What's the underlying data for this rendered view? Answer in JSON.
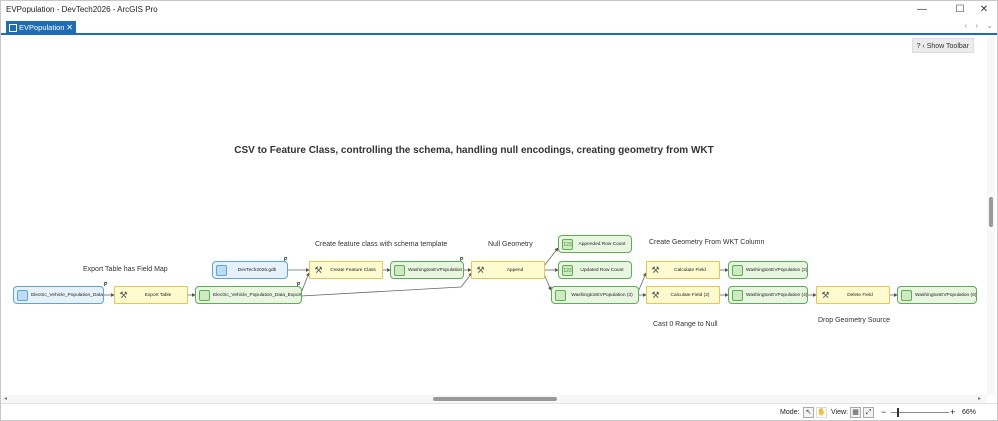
{
  "window": {
    "title": "EVPopulation - DevTech2026 - ArcGIS Pro",
    "minimize_glyph": "—",
    "maximize_glyph": "☐",
    "close_glyph": "✕"
  },
  "tab": {
    "label": "EVPopulation",
    "close_glyph": "✕"
  },
  "tab_nav": {
    "arrows": "‹ ›",
    "menu": "⌄"
  },
  "canvas": {
    "help_glyph": "?",
    "show_toolbar_label": "‹ Show Toolbar",
    "model_title": "CSV to Feature Class, controlling the schema, handling null encodings, creating geometry from WKT"
  },
  "nodes": [
    {
      "id": "n-csv",
      "kind": "data",
      "text": "Electric_Vehicle_Population_Data.csv"
    },
    {
      "id": "n-export-table",
      "kind": "tool",
      "text": "Export Table"
    },
    {
      "id": "n-export-output",
      "kind": "out",
      "text": "Electric_Vehicle_Population_Data_ExportTable"
    },
    {
      "id": "n-gdb",
      "kind": "data",
      "text": "DevTech2026.gdb"
    },
    {
      "id": "n-create-fc",
      "kind": "tool",
      "text": "Create Feature Class"
    },
    {
      "id": "n-wa-1",
      "kind": "out",
      "text": "WashingtonEVPopulation"
    },
    {
      "id": "n-append",
      "kind": "tool",
      "text": "Append"
    },
    {
      "id": "n-appended-count",
      "kind": "num",
      "text": "Appended Row Count"
    },
    {
      "id": "n-updated-count",
      "kind": "num",
      "text": "Updated Row Count"
    },
    {
      "id": "n-wa-3",
      "kind": "out",
      "text": "WashingtonEVPopulation (3)"
    },
    {
      "id": "n-calc-field",
      "kind": "tool",
      "text": "Calculate Field"
    },
    {
      "id": "n-calc-field-2",
      "kind": "tool",
      "text": "Calculate Field (2)"
    },
    {
      "id": "n-wa-2",
      "kind": "out",
      "text": "WashingtonEVPopulation (2)"
    },
    {
      "id": "n-wa-4",
      "kind": "out",
      "text": "WashingtonEVPopulation (4)"
    },
    {
      "id": "n-delete-field",
      "kind": "tool",
      "text": "Delete Field"
    },
    {
      "id": "n-wa-6",
      "kind": "out",
      "text": "WashingtonEVPopulation (6)"
    }
  ],
  "annotations": {
    "export_table_field_map": "Export Table has Field Map",
    "create_fc_schema": "Create feature class with schema template",
    "null_geometry": "Null Geometry",
    "create_geom_wkt": "Create Geometry From WKT Column",
    "cast_zero": "Cast 0 Range to Null",
    "drop_geom_source": "Drop Geometry Source"
  },
  "param_mark": "P",
  "num_icon_text": "123",
  "icons": {
    "tool": "⚒",
    "select_mode": "select-icon",
    "pan_mode": "hand-icon",
    "view_fit": "fit-view-icon",
    "view_full": "full-extent-icon"
  },
  "statusbar": {
    "mode_label": "Mode:",
    "view_label": "View:",
    "zoom_minus": "−",
    "zoom_plus": "+",
    "zoom_value": "66%",
    "zoom_fraction": 0.66
  },
  "colors": {
    "accent": "#1f6db5",
    "data_border": "#5aa6da",
    "tool_border": "#e7c84a",
    "output_border": "#5cae52"
  }
}
